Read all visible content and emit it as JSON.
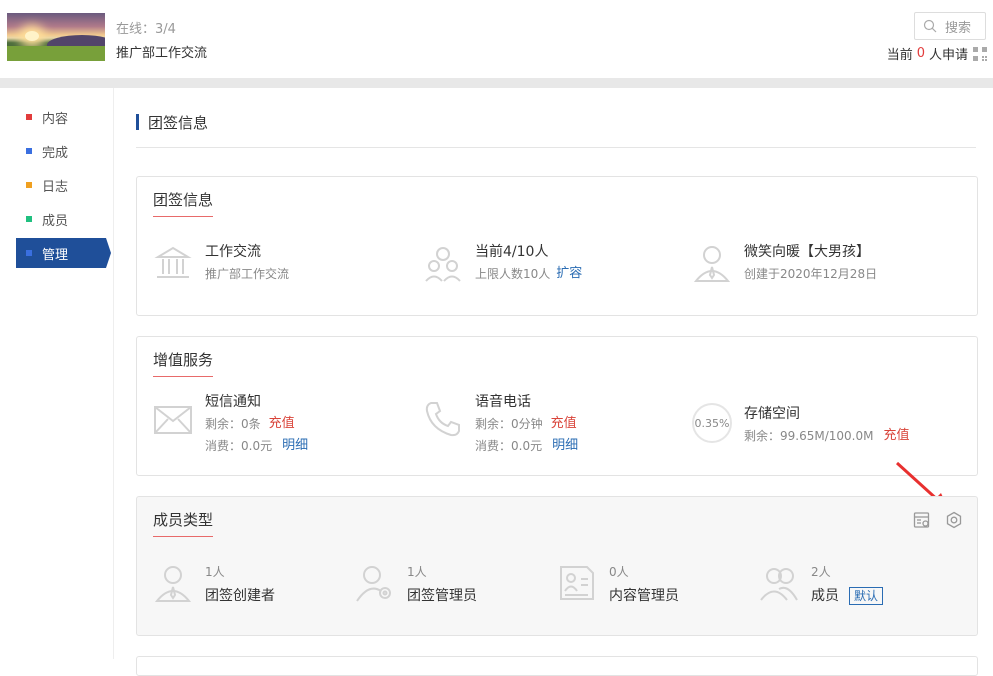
{
  "header": {
    "online_label": "在线：3/4",
    "team_name": "推广部工作交流",
    "search_placeholder": "搜索",
    "apply_prefix": "当前",
    "apply_count": "0",
    "apply_suffix": "人申请"
  },
  "sidebar": {
    "items": [
      {
        "label": "内容",
        "color": "#e23c3c"
      },
      {
        "label": "完成",
        "color": "#3a6fe0"
      },
      {
        "label": "日志",
        "color": "#f0a020"
      },
      {
        "label": "成员",
        "color": "#20c080"
      },
      {
        "label": "管理",
        "color": "#3a6fe0"
      }
    ]
  },
  "page": {
    "section_title": "团签信息"
  },
  "team_info": {
    "title": "团签信息",
    "name": {
      "title": "工作交流",
      "sub": "推广部工作交流"
    },
    "members": {
      "title": "当前4/10人",
      "sub": "上限人数10人",
      "link": "扩容"
    },
    "creator": {
      "title": "微笑向暖【大男孩】",
      "sub": "创建于2020年12月28日"
    }
  },
  "services": {
    "title": "增值服务",
    "sms": {
      "title": "短信通知",
      "remain": "剩余：0条",
      "recharge": "充值",
      "spent": "消费：0.0元",
      "detail": "明细"
    },
    "voice": {
      "title": "语音电话",
      "remain": "剩余：0分钟",
      "recharge": "充值",
      "spent": "消费：0.0元",
      "detail": "明细"
    },
    "storage": {
      "title": "存储空间",
      "percent": "0.35%",
      "remain": "剩余：99.65M/100.0M",
      "recharge": "充值"
    }
  },
  "member_types": {
    "title": "成员类型",
    "types": [
      {
        "count": "1人",
        "name": "团签创建者"
      },
      {
        "count": "1人",
        "name": "团签管理员"
      },
      {
        "count": "0人",
        "name": "内容管理员"
      },
      {
        "count": "2人",
        "name": "成员",
        "badge": "默认"
      }
    ]
  },
  "colors": {
    "accent": "#1f4f99",
    "link": "#2a6cb3",
    "recharge": "#d9443a",
    "arrow": "#e8302f"
  }
}
